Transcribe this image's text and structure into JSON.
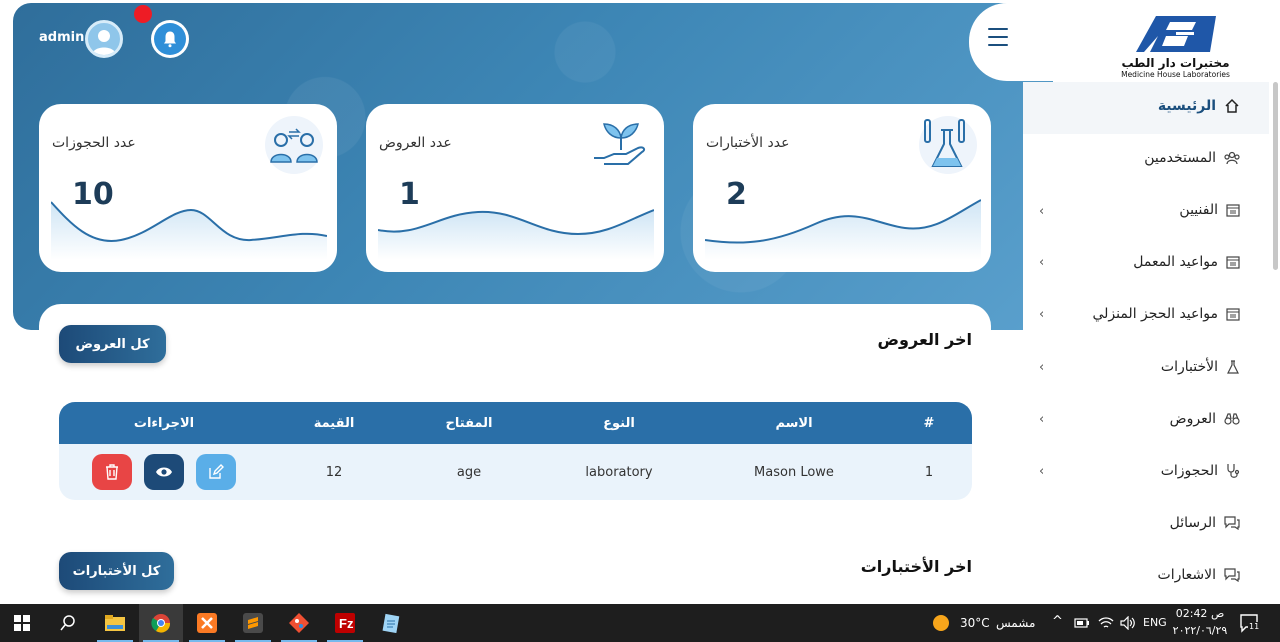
{
  "header": {
    "user_name": "admin",
    "menu_icon": "hamburger-icon",
    "notification_icon": "bell-icon"
  },
  "logo": {
    "arabic_name": "مختبرات دار الطب",
    "english_name": "Medicine House Laboratories"
  },
  "stats": [
    {
      "label": "عدد الأختبارات",
      "value": "2",
      "icon": "lab-flask-icon"
    },
    {
      "label": "عدد العروض",
      "value": "1",
      "icon": "plant-hand-icon"
    },
    {
      "label": "عدد الحجوزات",
      "value": "10",
      "icon": "people-exchange-icon"
    }
  ],
  "sidebar": {
    "items": [
      {
        "label": "الرئيسية",
        "icon": "home-icon",
        "active": true,
        "has_children": false
      },
      {
        "label": "المستخدمين",
        "icon": "users-icon",
        "has_children": false
      },
      {
        "label": "الفنيين",
        "icon": "calendar-icon",
        "has_children": true
      },
      {
        "label": "مواعيد المعمل",
        "icon": "calendar-icon",
        "has_children": true
      },
      {
        "label": "مواعيد الحجز المنزلي",
        "icon": "calendar-icon",
        "has_children": true
      },
      {
        "label": "الأختبارات",
        "icon": "flask-icon",
        "has_children": true
      },
      {
        "label": "العروض",
        "icon": "binoculars-icon",
        "has_children": true
      },
      {
        "label": "الحجوزات",
        "icon": "stethoscope-icon",
        "has_children": true
      },
      {
        "label": "الرسائل",
        "icon": "chat-icon",
        "has_children": false
      },
      {
        "label": "الاشعارات",
        "icon": "chat-icon",
        "has_children": false
      }
    ]
  },
  "latest_offers": {
    "title": "اخر العروض",
    "button_label": "كل العروض",
    "columns": [
      "#",
      "الاسم",
      "النوع",
      "المفتاح",
      "القيمة",
      "الاجراءات"
    ],
    "rows": [
      {
        "index": "1",
        "name": "Mason Lowe",
        "type": "laboratory",
        "key": "age",
        "value": "12"
      }
    ]
  },
  "latest_tests": {
    "title": "اخر الأختبارات",
    "button_label": "كل الأختبارات"
  },
  "taskbar": {
    "weather_temp": "30°C",
    "weather_label": "مشمس",
    "language": "ENG",
    "time": "02:42 ص",
    "date": "٢٠٢٢/٠٦/٢٩",
    "notification_count": "11",
    "apps": [
      "windows-start-icon",
      "search-icon",
      "file-explorer-icon",
      "chrome-icon",
      "xampp-icon",
      "sublime-icon",
      "git-icon",
      "filezilla-icon",
      "notepad-icon"
    ]
  },
  "colors": {
    "brand_dark": "#1d4a78",
    "brand_primary": "#2a6fa8",
    "danger": "#e84545",
    "info": "#5aaee8",
    "notification_dot": "#ee1c25"
  }
}
